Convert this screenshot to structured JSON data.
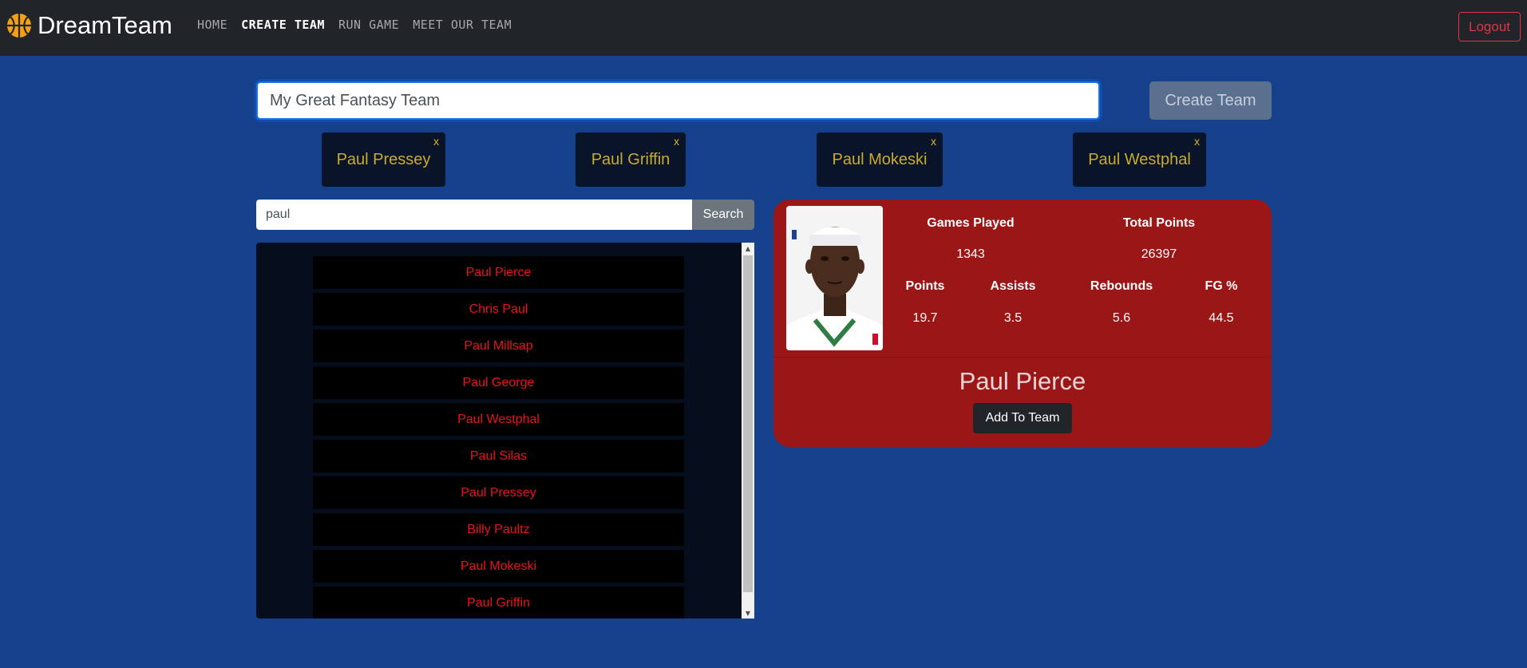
{
  "navbar": {
    "brand": "DreamTeam",
    "links": [
      "HOME",
      "CREATE TEAM",
      "RUN GAME",
      "MEET OUR TEAM"
    ],
    "active_link": "CREATE TEAM",
    "logout_label": "Logout"
  },
  "team": {
    "name_value": "My Great Fantasy Team",
    "create_label": "Create Team",
    "selected_players": [
      {
        "name": "Paul Pressey",
        "remove": "x"
      },
      {
        "name": "Paul Griffin",
        "remove": "x"
      },
      {
        "name": "Paul Mokeski",
        "remove": "x"
      },
      {
        "name": "Paul Westphal",
        "remove": "x"
      }
    ]
  },
  "search": {
    "value": "paul",
    "button_label": "Search",
    "results": [
      "Paul Pierce",
      "Chris Paul",
      "Paul Millsap",
      "Paul George",
      "Paul Westphal",
      "Paul Silas",
      "Paul Pressey",
      "Billy Paultz",
      "Paul Mokeski",
      "Paul Griffin"
    ]
  },
  "player_card": {
    "name": "Paul Pierce",
    "add_label": "Add To Team",
    "stats_top": [
      {
        "label": "Games Played",
        "value": "1343"
      },
      {
        "label": "Total Points",
        "value": "26397"
      }
    ],
    "stats_bottom": [
      {
        "label": "Points",
        "value": "19.7"
      },
      {
        "label": "Assists",
        "value": "3.5"
      },
      {
        "label": "Rebounds",
        "value": "5.6"
      },
      {
        "label": "FG %",
        "value": "44.5"
      }
    ]
  },
  "colors": {
    "background": "#15418c",
    "navbar": "#212529",
    "card": "#9b1717",
    "chip_text": "#c9ab2c",
    "result_text": "#e8141b",
    "logout": "#dc3545"
  },
  "icons": {
    "brand": "basketball-icon",
    "scroll_up": "triangle-up-icon",
    "scroll_down": "triangle-down-icon"
  }
}
